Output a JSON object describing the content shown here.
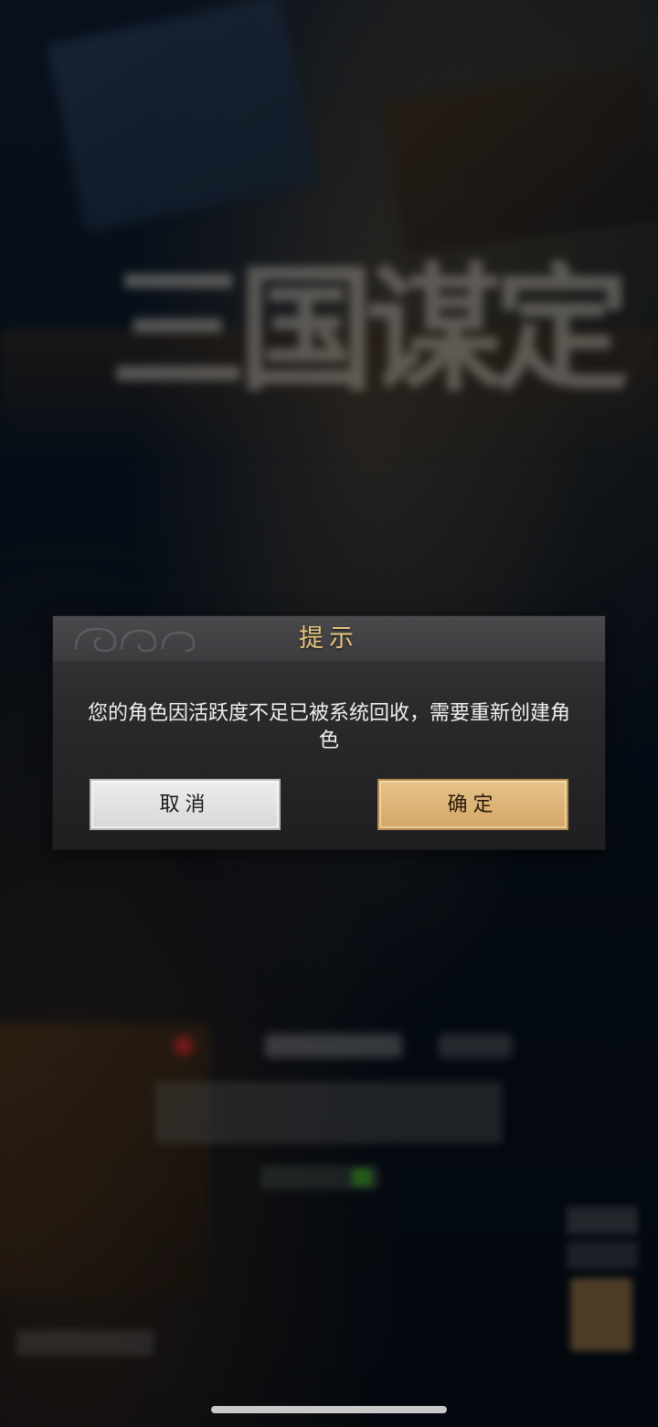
{
  "dialog": {
    "title": "提示",
    "message": "您的角色因活跃度不足已被系统回收，需要重新创建角色",
    "cancel_label": "取消",
    "confirm_label": "确定"
  },
  "background": {
    "logo_text": "三国谋定"
  },
  "colors": {
    "title_gold": "#e7c67f",
    "confirm_button": "#d9ae70",
    "cancel_button": "#e4e3e1",
    "dialog_bg": "#2e2e30"
  }
}
